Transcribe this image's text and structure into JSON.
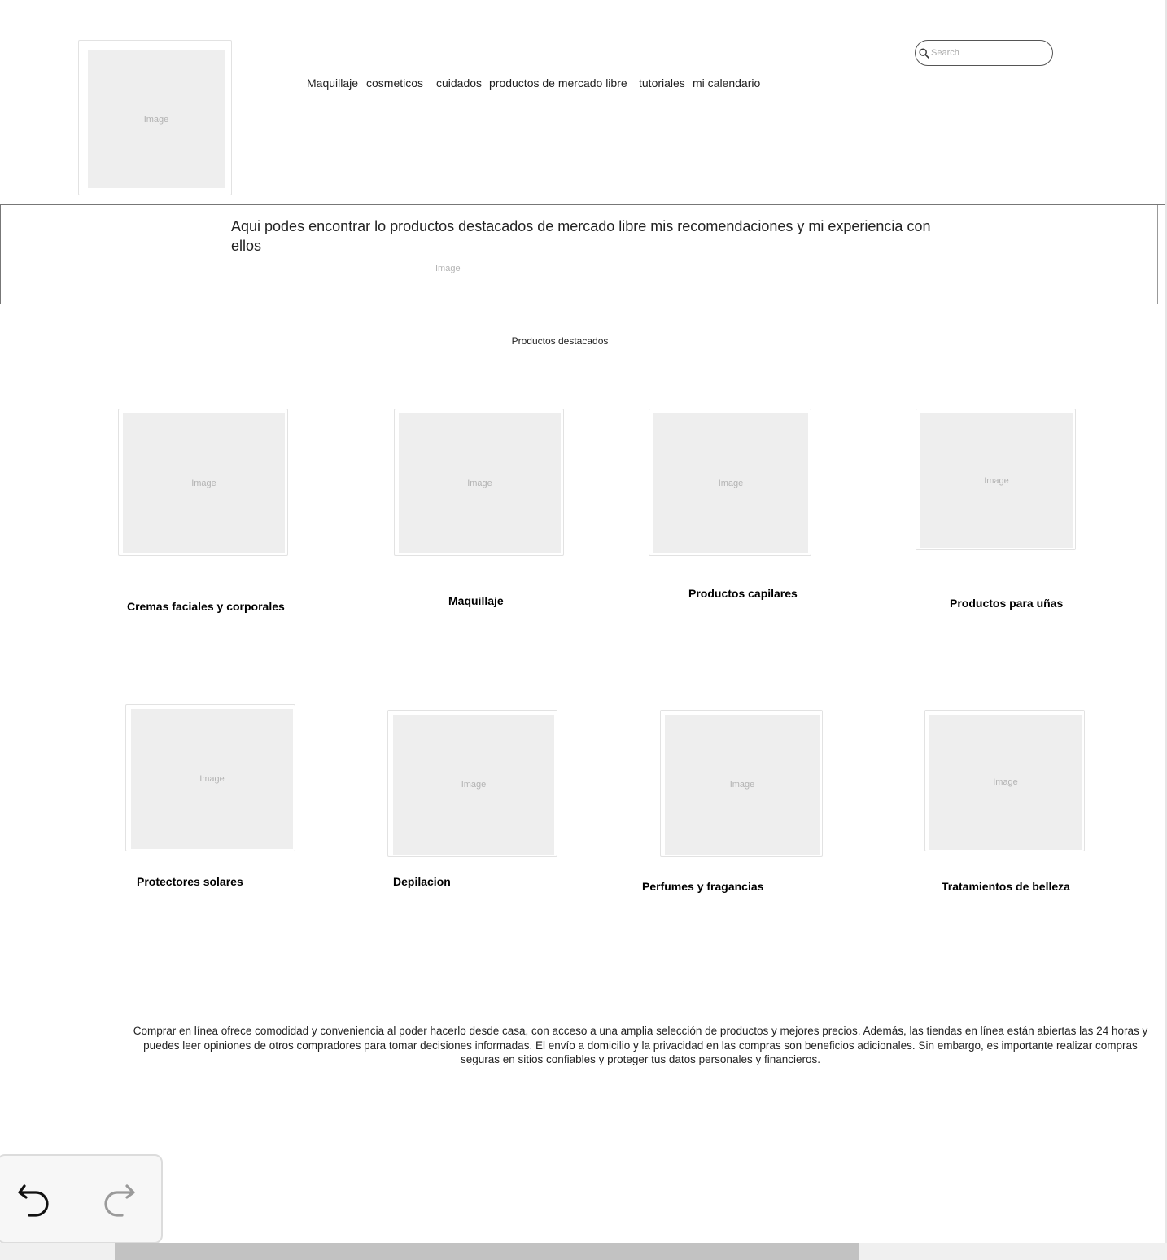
{
  "header": {
    "logo": {
      "placeholder": "Image"
    },
    "nav": [
      {
        "label": "Maquillaje"
      },
      {
        "label": "cosmeticos"
      },
      {
        "label": "cuidados"
      },
      {
        "label": "productos de mercado libre"
      },
      {
        "label": "tutoriales"
      },
      {
        "label": "mi calendario"
      }
    ],
    "search": {
      "placeholder": "Search",
      "value": ""
    }
  },
  "banner": {
    "text": "Aqui podes encontrar lo productos destacados de mercado libre mis recomendaciones y mi experiencia con ellos",
    "image_placeholder": "Image"
  },
  "featured": {
    "title": "Productos destacados",
    "placeholder": "Image",
    "categories": [
      {
        "label": "Cremas faciales y corporales"
      },
      {
        "label": "Maquillaje"
      },
      {
        "label": "Productos capilares"
      },
      {
        "label": "Productos para uñas"
      },
      {
        "label": "Protectores solares"
      },
      {
        "label": "Depilacion"
      },
      {
        "label": "Perfumes y fragancias"
      },
      {
        "label": "Tratamientos de belleza"
      }
    ]
  },
  "footer": {
    "text": "Comprar en línea ofrece comodidad y conveniencia al poder hacerlo desde casa, con acceso a una amplia selección de productos y mejores precios. Además, las tiendas en línea están abiertas las 24 horas y puedes leer opiniones de otros compradores para tomar decisiones informadas. El envío a domicilio y la privacidad en las compras son beneficios adicionales. Sin embargo, es importante realizar compras seguras en sitios confiables y proteger tus datos personales y financieros."
  },
  "toolbar": {
    "undo_icon": "undo-icon",
    "redo_icon": "redo-icon"
  },
  "scrollbar": {
    "position": 0.098,
    "visible_fraction": 0.638
  }
}
